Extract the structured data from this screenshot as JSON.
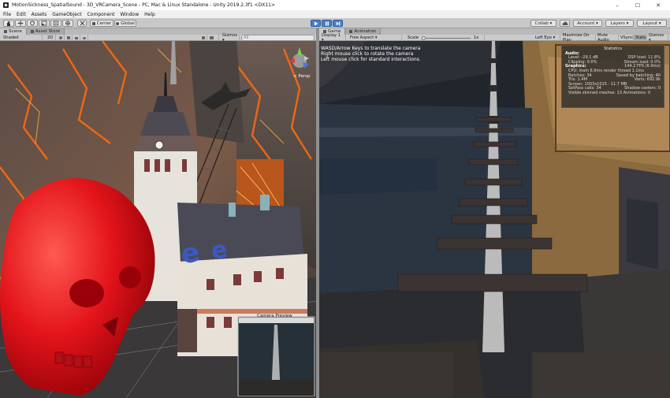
{
  "window": {
    "title": "MotionSickness_SpatialSound - 3D_VRCamera_Scene - PC, Mac & Linux Standalone - Unity 2019.2.3f1 <DX11>",
    "minimize": "–",
    "maximize": "☐",
    "close": "✕"
  },
  "menu": [
    "File",
    "Edit",
    "Assets",
    "GameObject",
    "Component",
    "Window",
    "Help"
  ],
  "toolbar": {
    "pivot": "Center",
    "space": "Global",
    "collab": "Collab ▾",
    "account": "Account ▾",
    "layers": "Layers ▾",
    "layout": "Layout ▾"
  },
  "scene_tabs": [
    "Scene",
    "Asset Store"
  ],
  "game_tabs": [
    "Game",
    "Animation"
  ],
  "scene_toolbar": {
    "shading": "Shaded",
    "mode_2d": "2D",
    "gizmos": "Gizmos ▾",
    "search_placeholder": "All"
  },
  "game_toolbar": {
    "display": "Display 1 ▾",
    "aspect": "Free Aspect ▾",
    "scale_label": "Scale",
    "scale_value": "1x",
    "eye": "Left Eye ▾",
    "maximize": "Maximize On Play",
    "mute": "Mute Audio",
    "vsync": "VSync",
    "stats": "Stats",
    "gizmos": "Gizmos ▾"
  },
  "scene_overlay": {
    "persp": "< Persp",
    "camera_preview": "Camera Preview"
  },
  "game_overlay": {
    "help_lines": [
      "WASD/Arrow Keys to translate the camera",
      "Right mouse click to rotate the camera",
      "Left mouse click for standard interactions."
    ]
  },
  "stats": {
    "title": "Statistics",
    "audio_label": "Audio:",
    "level": "Level: -29.1 dB",
    "clipping": "Clipping: 0.0%",
    "dsp": "DSP load: 11.8%",
    "stream": "Stream load: 0.0%",
    "graphics_label": "Graphics:",
    "fps": "144.2 FPS (6.9ms)",
    "cpu": "CPU: main 6.9ms  render thread 1.1ms",
    "batches": "Batches: 34",
    "saved": "Saved by batching: 40",
    "tris": "Tris: 1.4M",
    "verts": "Verts: 692.9k",
    "screen": "Screen: 1003x1015 - 11.7 MB",
    "setpass": "SetPass calls: 34",
    "shadow": "Shadow casters: 0",
    "skinned": "Visible skinned meshes: 13  Animations: 0"
  },
  "colors": {
    "play_active": "#4a7fc7",
    "skull_red": "#e3141a",
    "lava_orange": "#ff6a10",
    "sky_dark": "#20262c"
  },
  "icons": {
    "hand": "hand-tool-icon",
    "move": "move-tool-icon",
    "rotate": "rotate-tool-icon",
    "scale": "scale-tool-icon",
    "rect": "rect-tool-icon",
    "transform": "transform-tool-icon",
    "play": "play-icon",
    "pause": "pause-icon",
    "step": "step-icon"
  }
}
